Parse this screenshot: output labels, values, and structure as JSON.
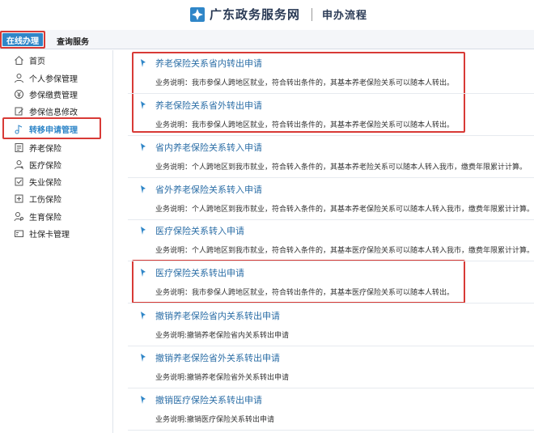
{
  "header": {
    "title": "广东政务服务网",
    "subtitle": "申办流程"
  },
  "tabs": [
    {
      "label": "在线办理",
      "active": true
    },
    {
      "label": "查询服务",
      "active": false
    }
  ],
  "sidebar": {
    "items": [
      {
        "label": "首页",
        "icon": "home-icon"
      },
      {
        "label": "个人参保管理",
        "icon": "person-icon"
      },
      {
        "label": "参保缴费管理",
        "icon": "payment-icon"
      },
      {
        "label": "参保信息修改",
        "icon": "edit-icon"
      },
      {
        "label": "转移申请管理",
        "icon": "transfer-icon",
        "active": true
      },
      {
        "label": "养老保险",
        "icon": "pension-icon"
      },
      {
        "label": "医疗保险",
        "icon": "medical-icon"
      },
      {
        "label": "失业保险",
        "icon": "unemployment-icon"
      },
      {
        "label": "工伤保险",
        "icon": "injury-icon"
      },
      {
        "label": "生育保险",
        "icon": "maternity-icon"
      },
      {
        "label": "社保卡管理",
        "icon": "card-icon"
      }
    ]
  },
  "entries": [
    {
      "title": "养老保险关系省内转出申请",
      "desc": "业务说明：我市参保人跨地区就业，符合转出条件的，其基本养老保险关系可以随本人转出。"
    },
    {
      "title": "养老保险关系省外转出申请",
      "desc": "业务说明：我市参保人跨地区就业，符合转出条件的，其基本养老保险关系可以随本人转出。"
    },
    {
      "title": "省内养老保险关系转入申请",
      "desc": "业务说明：个人跨地区到我市就业，符合转入条件的，其基本养老险关系可以随本人转入我市，缴费年限累计计算。"
    },
    {
      "title": "省外养老保险关系转入申请",
      "desc": "业务说明：个人跨地区到我市就业，符合转入条件的，其基本养老保险关系可以随本人转入我市，缴费年限累计计算。"
    },
    {
      "title": "医疗保险关系转入申请",
      "desc": "业务说明：个人跨地区到我市就业，符合转入条件的，其基本医疗保险关系可以随本人转入我市，缴费年限累计计算。"
    },
    {
      "title": "医疗保险关系转出申请",
      "desc": "业务说明：我市参保人跨地区就业，符合转出条件的，其基本医疗保险关系可以随本人转出。"
    },
    {
      "title": "撤销养老保险省内关系转出申请",
      "desc": "业务说明:撤销养老保险省内关系转出申请"
    },
    {
      "title": "撤销养老保险省外关系转出申请",
      "desc": "业务说明:撤销养老保险省外关系转出申请"
    },
    {
      "title": "撤销医疗保险关系转出申请",
      "desc": "业务说明:撤销医疗保险关系转出申请"
    }
  ],
  "colors": {
    "accent": "#2f86c8",
    "link": "#2d6fa7",
    "highlight_border": "#d83a36"
  }
}
